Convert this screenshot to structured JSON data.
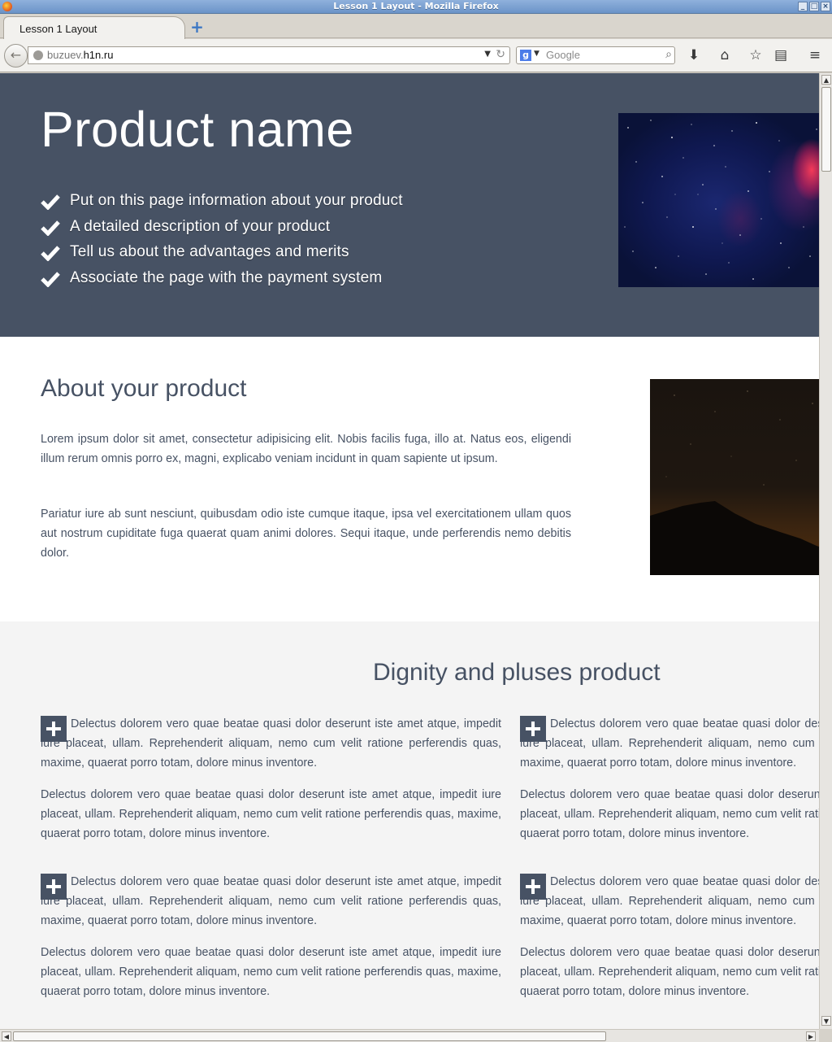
{
  "window": {
    "title": "Lesson 1 Layout - Mozilla Firefox"
  },
  "tabs": [
    {
      "label": "Lesson 1 Layout"
    }
  ],
  "navbar": {
    "url_prefix": "buzuev.",
    "url_domain": "h1n.ru",
    "search_placeholder": "Google"
  },
  "hero": {
    "title": "Product name",
    "features": [
      "Put on this page information about your product",
      "A detailed description of your product",
      "Tell us about the advantages and merits",
      "Associate the page with the payment system"
    ]
  },
  "about": {
    "heading": "About your product",
    "paragraphs": [
      "Lorem ipsum dolor sit amet, consectetur adipisicing elit. Nobis facilis fuga, illo at. Natus eos, eligendi illum rerum omnis porro ex, magni, explicabo veniam incidunt in quam sapiente ut ipsum.",
      "Pariatur iure ab sunt nesciunt, quibusdam odio iste cumque itaque, ipsa vel exercitationem ullam quos aut nostrum cupiditate fuga quaerat quam animi dolores. Sequi itaque, unde perferendis nemo debitis dolor."
    ]
  },
  "dignity": {
    "heading": "Dignity and pluses product",
    "cards": [
      {
        "first": "Delectus dolorem vero quae beatae quasi dolor deserunt iste amet atque, impedit iure placeat, ullam. Reprehenderit aliquam, nemo cum velit ratione perferendis quas, maxime, quaerat porro totam, dolore minus inventore.",
        "second": "Delectus dolorem vero quae beatae quasi dolor deserunt iste amet atque, impedit iure placeat, ullam. Reprehenderit aliquam, nemo cum velit ratione perferendis quas, maxime, quaerat porro totam, dolore minus inventore."
      },
      {
        "first": "Delectus dolorem vero quae beatae quasi dolor deserunt iste amet atque, impedit iure placeat, ullam. Reprehenderit aliquam, nemo cum velit ratione perferendis quas, maxime, quaerat porro totam, dolore minus inventore.",
        "second": "Delectus dolorem vero quae beatae quasi dolor deserunt iste amet atque, impedit iure placeat, ullam. Reprehenderit aliquam, nemo cum velit ratione perferendis quas, maxime, quaerat porro totam, dolore minus inventore."
      },
      {
        "first": "Delectus dolorem vero quae beatae quasi dolor deserunt iste amet atque, impedit iure placeat, ullam. Reprehenderit aliquam, nemo cum velit ratione perferendis quas, maxime, quaerat porro totam, dolore minus inventore.",
        "second": "Delectus dolorem vero quae beatae quasi dolor deserunt iste amet atque, impedit iure placeat, ullam. Reprehenderit aliquam, nemo cum velit ratione perferendis quas, maxime, quaerat porro totam, dolore minus inventore."
      },
      {
        "first": "Delectus dolorem vero quae beatae quasi dolor deserunt iste amet atque, impedit iure placeat, ullam. Reprehenderit aliquam, nemo cum velit ratione perferendis quas, maxime, quaerat porro totam, dolore minus inventore.",
        "second": "Delectus dolorem vero quae beatae quasi dolor deserunt iste amet atque, impedit iure placeat, ullam. Reprehenderit aliquam, nemo cum velit ratione perferendis quas, maxime, quaerat porro totam, dolore minus inventore."
      }
    ]
  },
  "colors": {
    "hero_bg": "#475264",
    "text": "#475264",
    "section_alt_bg": "#f4f4f4",
    "titlebar": "#7aa0d2"
  },
  "icons": {
    "feature_bullet": "check-icon",
    "card_bullet": "plus-icon"
  }
}
